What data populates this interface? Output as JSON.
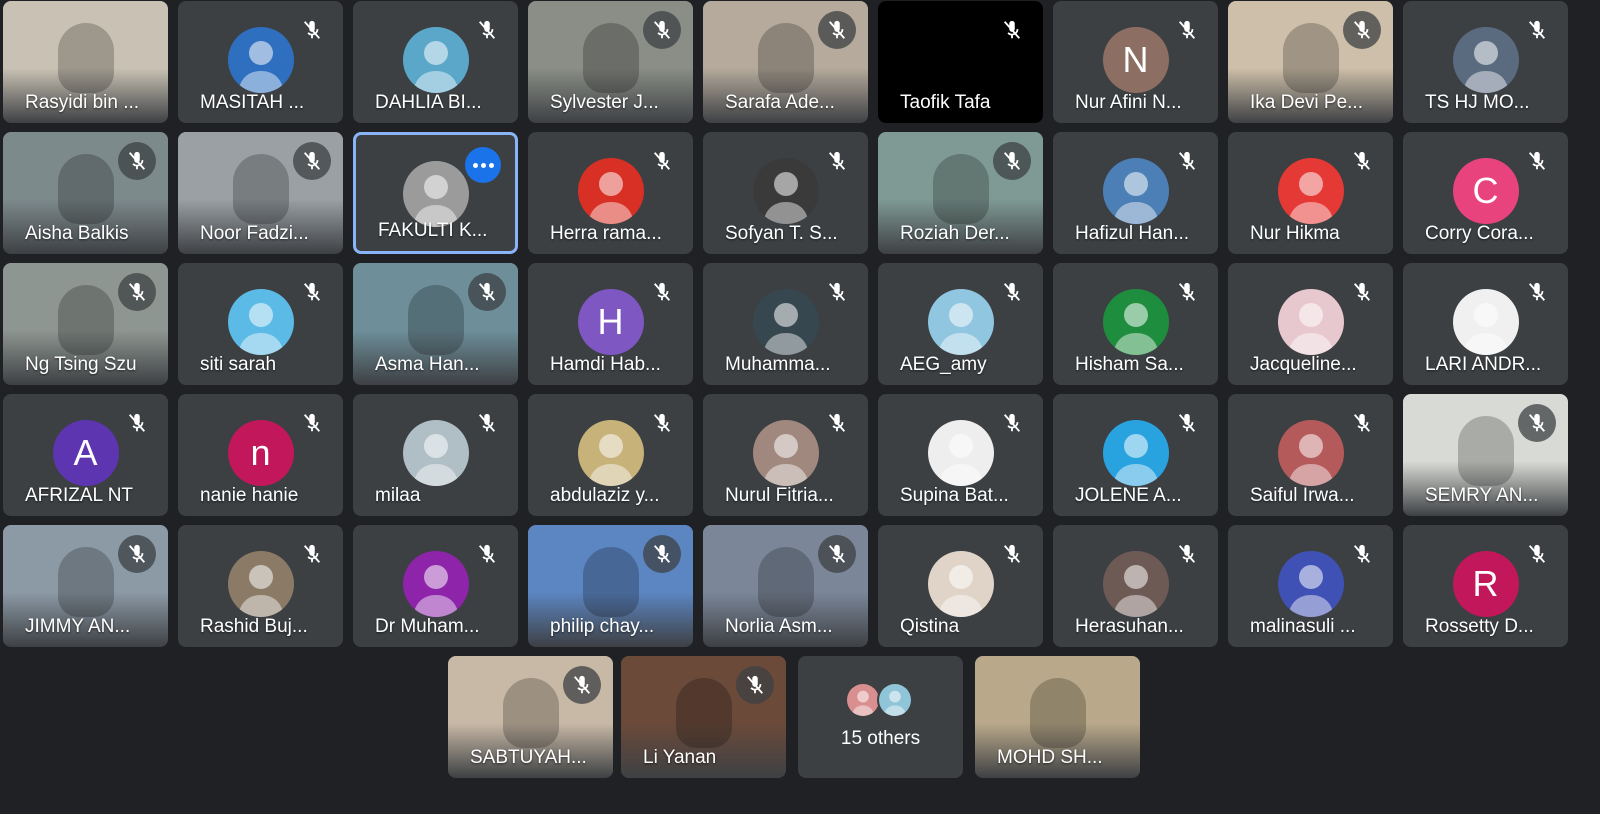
{
  "meeting": {
    "colors": {
      "background": "#202124",
      "tile": "#3c4043",
      "active_border": "#8ab4f8",
      "more_button": "#1a73e8"
    }
  },
  "participants": [
    {
      "name": "Rasyidi bin ...",
      "kind": "video",
      "bg": "#c9c2b4",
      "mic": false
    },
    {
      "name": "MASITAH ...",
      "kind": "photo",
      "color": "#2f6fbf",
      "mic": true
    },
    {
      "name": "DAHLIA BI...",
      "kind": "photo",
      "color": "#5aa7c9",
      "mic": true
    },
    {
      "name": "Sylvester J...",
      "kind": "video",
      "bg": "#8a8e86",
      "mic": true
    },
    {
      "name": "Sarafa Ade...",
      "kind": "video",
      "bg": "#b5aa9c",
      "mic": true
    },
    {
      "name": "Taofik Tafa",
      "kind": "black",
      "mic": true
    },
    {
      "name": "Nur Afini N...",
      "kind": "letter",
      "letter": "N",
      "color": "#8d6e63",
      "mic": true
    },
    {
      "name": "Ika Devi Pe...",
      "kind": "video",
      "bg": "#cdbfa9",
      "mic": true
    },
    {
      "name": "TS HJ MO...",
      "kind": "photo",
      "color": "#5a6b80",
      "mic": true
    },
    {
      "name": "Aisha Balkis",
      "kind": "video",
      "bg": "#7d8a8c",
      "mic": true
    },
    {
      "name": "Noor Fadzi...",
      "kind": "video",
      "bg": "#9aa0a4",
      "mic": true
    },
    {
      "name": "FAKULTI K...",
      "kind": "logo",
      "color": "#9b9b9b",
      "mic": false,
      "active": true
    },
    {
      "name": "Herra rama...",
      "kind": "photo",
      "color": "#d93025",
      "mic": true
    },
    {
      "name": "Sofyan T. S...",
      "kind": "photo",
      "color": "#3a3a3a",
      "mic": true
    },
    {
      "name": "Roziah Der...",
      "kind": "video",
      "bg": "#7f9a94",
      "mic": true
    },
    {
      "name": "Hafizul Han...",
      "kind": "photo",
      "color": "#4c7fb5",
      "mic": true
    },
    {
      "name": "Nur Hikma",
      "kind": "photo",
      "color": "#e53935",
      "mic": true
    },
    {
      "name": "Corry Cora...",
      "kind": "letter",
      "letter": "C",
      "color": "#e8437c",
      "mic": true
    },
    {
      "name": "Ng Tsing Szu",
      "kind": "video",
      "bg": "#8e9691",
      "mic": true
    },
    {
      "name": "siti sarah",
      "kind": "photo",
      "color": "#5bbbe6",
      "mic": true
    },
    {
      "name": "Asma Han...",
      "kind": "video",
      "bg": "#6e8f9a",
      "mic": true
    },
    {
      "name": "Hamdi Hab...",
      "kind": "letter",
      "letter": "H",
      "color": "#7e57c2",
      "mic": true
    },
    {
      "name": "Muhamma...",
      "kind": "photo",
      "color": "#37474f",
      "mic": true
    },
    {
      "name": "AEG_amy",
      "kind": "photo",
      "color": "#90c6e0",
      "mic": true
    },
    {
      "name": "Hisham Sa...",
      "kind": "photo",
      "color": "#1e8e3e",
      "mic": true
    },
    {
      "name": "Jacqueline...",
      "kind": "photo",
      "color": "#e8c8cf",
      "mic": true
    },
    {
      "name": "LARI ANDR...",
      "kind": "photo",
      "color": "#f0f0f0",
      "mic": true
    },
    {
      "name": "AFRIZAL NT",
      "kind": "letter",
      "letter": "A",
      "color": "#5e35b1",
      "mic": true
    },
    {
      "name": "nanie hanie",
      "kind": "letter",
      "letter": "n",
      "color": "#c2185b",
      "mic": true
    },
    {
      "name": "milaa",
      "kind": "photo",
      "color": "#b0bec5",
      "mic": true
    },
    {
      "name": "abdulaziz y...",
      "kind": "photo",
      "color": "#c7b27a",
      "mic": true
    },
    {
      "name": "Nurul Fitria...",
      "kind": "photo",
      "color": "#a1887f",
      "mic": true
    },
    {
      "name": "Supina Bat...",
      "kind": "photo",
      "color": "#eeeeee",
      "mic": true
    },
    {
      "name": "JOLENE A...",
      "kind": "photo",
      "color": "#29a3e0",
      "mic": true
    },
    {
      "name": "Saiful Irwa...",
      "kind": "photo",
      "color": "#b55a5a",
      "mic": true
    },
    {
      "name": "SEMRY AN...",
      "kind": "video",
      "bg": "#d8dbd5",
      "mic": true
    },
    {
      "name": "JIMMY AN...",
      "kind": "video",
      "bg": "#8c9aa6",
      "mic": true
    },
    {
      "name": "Rashid Buj...",
      "kind": "photo",
      "color": "#8a7a66",
      "mic": true
    },
    {
      "name": "Dr Muham...",
      "kind": "photo",
      "color": "#8e24aa",
      "mic": true
    },
    {
      "name": "philip chay...",
      "kind": "video",
      "bg": "#5c86c2",
      "mic": true
    },
    {
      "name": "Norlia Asm...",
      "kind": "video",
      "bg": "#7b8799",
      "mic": true
    },
    {
      "name": "Qistina",
      "kind": "photo",
      "color": "#e0d4c8",
      "mic": true
    },
    {
      "name": "Herasuhan...",
      "kind": "photo",
      "color": "#6d5a55",
      "mic": true
    },
    {
      "name": "malinasuli ...",
      "kind": "photo",
      "color": "#3f51b5",
      "mic": true
    },
    {
      "name": "Rossetty D...",
      "kind": "letter",
      "letter": "R",
      "color": "#c2185b",
      "mic": true
    },
    {
      "name": "SABTUYAH...",
      "kind": "video",
      "bg": "#c8b9a6",
      "mic": true
    },
    {
      "name": "Li Yanan",
      "kind": "video",
      "bg": "#6b4a3a",
      "mic": true
    },
    {
      "name": "15 others",
      "kind": "others",
      "mic": false
    },
    {
      "name": "MOHD SH...",
      "kind": "video",
      "bg": "#b9a98a",
      "mic": false
    }
  ]
}
